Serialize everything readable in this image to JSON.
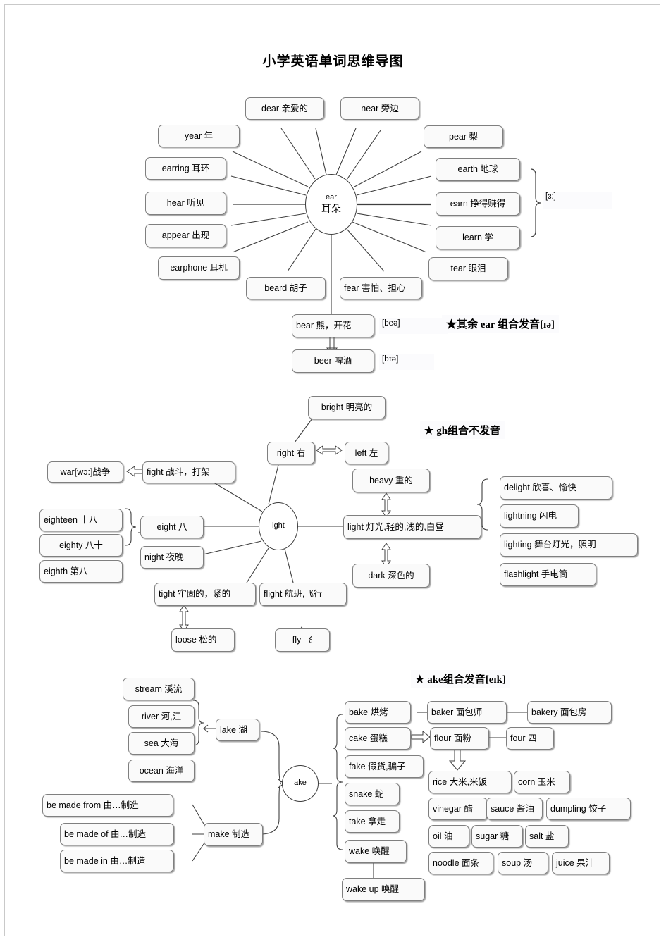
{
  "title": "小学英语单词思维导图",
  "sections": [
    {
      "id": "ear",
      "center": {
        "word": "ear",
        "cn": "耳朵"
      },
      "left_boxes": [
        {
          "label": "year  年"
        },
        {
          "label": "earring  耳环"
        },
        {
          "label": "hear  听见"
        },
        {
          "label": "appear  出现"
        },
        {
          "label": "earphone  耳机"
        }
      ],
      "top_boxes": [
        {
          "label": "dear  亲爱的"
        },
        {
          "label": "near  旁边"
        }
      ],
      "right_boxes": [
        {
          "label": "pear  梨"
        },
        {
          "label": "earth  地球"
        },
        {
          "label": "earn  挣得赚得"
        },
        {
          "label": "learn  学"
        },
        {
          "label": "tear  眼泪"
        }
      ],
      "bottom_boxes": [
        {
          "label": "beard  胡子"
        },
        {
          "label": "fear  害怕、担心"
        },
        {
          "label": "bear  熊，开花"
        },
        {
          "label": "beer  啤酒"
        }
      ],
      "bracket_phonetic": "[ɜ:]",
      "phonetics": [
        {
          "label": "[beə]"
        },
        {
          "label": "[bɪə]"
        }
      ],
      "note": "★其余 ear 组合发音[ɪə]"
    },
    {
      "id": "ight",
      "center": {
        "word": "ight",
        "cn": ""
      },
      "note": "★  gh组合不发音",
      "boxes": [
        {
          "label": "bright  明亮的"
        },
        {
          "label": "right  右"
        },
        {
          "label": "left  左"
        },
        {
          "label": "war[wɔ:]战争"
        },
        {
          "label": "fight  战斗，打架"
        },
        {
          "label": "eighteen  十八"
        },
        {
          "label": "eighty  八十"
        },
        {
          "label": "eighth  第八"
        },
        {
          "label": "eight  八"
        },
        {
          "label": "night  夜晚"
        },
        {
          "label": "heavy  重的"
        },
        {
          "label": "light  灯光,轻的,浅的,白昼"
        },
        {
          "label": "dark  深色的"
        },
        {
          "label": "delight  欣喜、愉快"
        },
        {
          "label": "lightning  闪电"
        },
        {
          "label": "lighting  舞台灯光，照明"
        },
        {
          "label": "flashlight  手电筒"
        },
        {
          "label": "tight  牢固的，紧的"
        },
        {
          "label": "loose  松的"
        },
        {
          "label": "flight  航班,飞行"
        },
        {
          "label": "fly  飞"
        }
      ]
    },
    {
      "id": "ake",
      "center": {
        "word": "ake",
        "cn": ""
      },
      "note": "★  ake组合发音[eɪk]",
      "boxes": [
        {
          "label": "stream  溪流"
        },
        {
          "label": "river  河,江"
        },
        {
          "label": "sea  大海"
        },
        {
          "label": "ocean  海洋"
        },
        {
          "label": "lake  湖"
        },
        {
          "label": "be made from  由…制造"
        },
        {
          "label": "be made of  由…制造"
        },
        {
          "label": "be made in  由…制造"
        },
        {
          "label": "make  制造"
        },
        {
          "label": "bake  烘烤"
        },
        {
          "label": "cake  蛋糕"
        },
        {
          "label": "fake  假货,骗子"
        },
        {
          "label": "snake  蛇"
        },
        {
          "label": "take  拿走"
        },
        {
          "label": "wake  唤醒"
        },
        {
          "label": "wake up  唤醒"
        },
        {
          "label": "baker  面包师"
        },
        {
          "label": "bakery  面包房"
        },
        {
          "label": "flour  面粉"
        },
        {
          "label": "four  四"
        },
        {
          "label": "rice  大米,米饭"
        },
        {
          "label": "corn  玉米"
        },
        {
          "label": "vinegar  醋"
        },
        {
          "label": "sauce  酱油"
        },
        {
          "label": "dumpling  饺子"
        },
        {
          "label": "oil  油"
        },
        {
          "label": "sugar  糖"
        },
        {
          "label": "salt  盐"
        },
        {
          "label": "noodle  面条"
        },
        {
          "label": "soup  汤"
        },
        {
          "label": "juice  果汁"
        }
      ]
    }
  ]
}
